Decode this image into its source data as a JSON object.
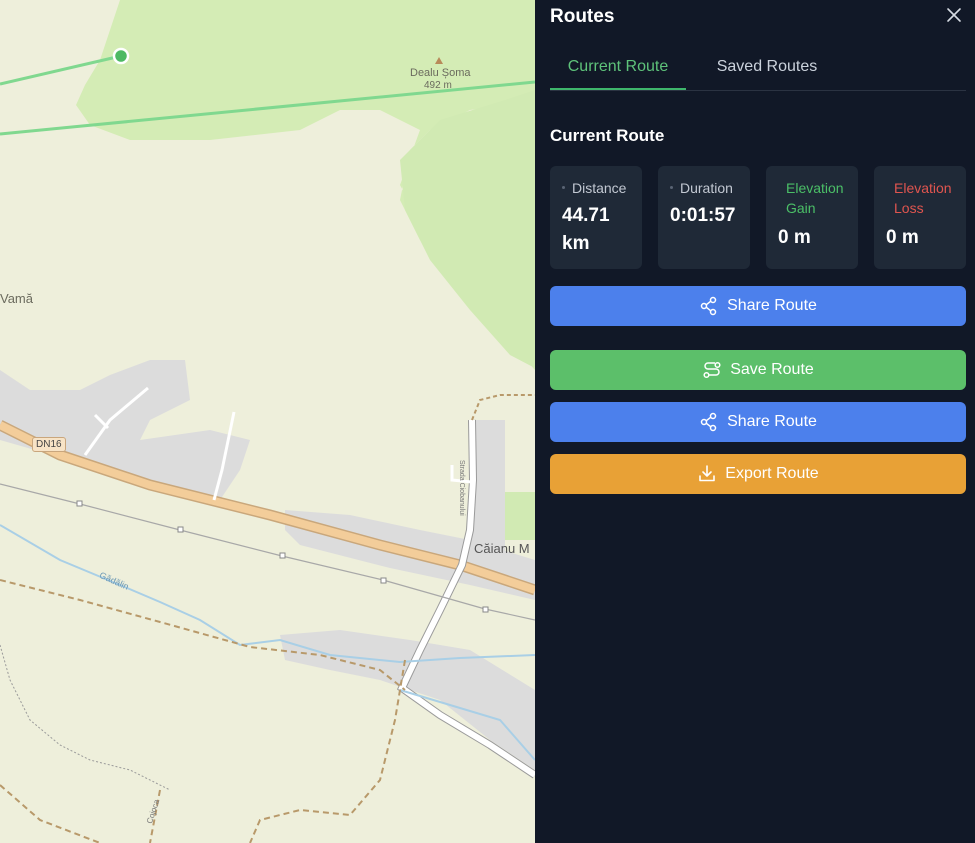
{
  "map": {
    "labels": {
      "peak_name": "Dealu Șoma",
      "peak_elevation": "492 m",
      "village_left": "Vamă",
      "road_number": "DN16",
      "town": "Căianu M",
      "stream": "Gădălin",
      "street": "Strada Ciobanului",
      "creek": "Cojoca"
    }
  },
  "panel": {
    "title": "Routes",
    "close_icon": "close-icon",
    "tabs": [
      {
        "label": "Current Route",
        "active": true
      },
      {
        "label": "Saved Routes",
        "active": false
      }
    ],
    "section_title": "Current Route",
    "stats": {
      "distance": {
        "label": "Distance",
        "value": "44.71 km"
      },
      "duration": {
        "label": "Duration",
        "value": "0:01:57"
      },
      "elevation_gain": {
        "label": "Elevation Gain",
        "value": "0 m"
      },
      "elevation_loss": {
        "label": "Elevation Loss",
        "value": "0 m"
      }
    },
    "buttons": {
      "share_top": {
        "label": "Share Route",
        "icon": "share-icon"
      },
      "save": {
        "label": "Save Route",
        "icon": "route-icon"
      },
      "share": {
        "label": "Share Route",
        "icon": "share-icon"
      },
      "export": {
        "label": "Export Route",
        "icon": "download-icon"
      }
    }
  },
  "colors": {
    "panel_bg": "#111827",
    "card_bg": "#1f2937",
    "accent_green": "#5cbf6a",
    "accent_blue": "#4c80ec",
    "accent_orange": "#e8a136",
    "loss_red": "#e0554f"
  }
}
